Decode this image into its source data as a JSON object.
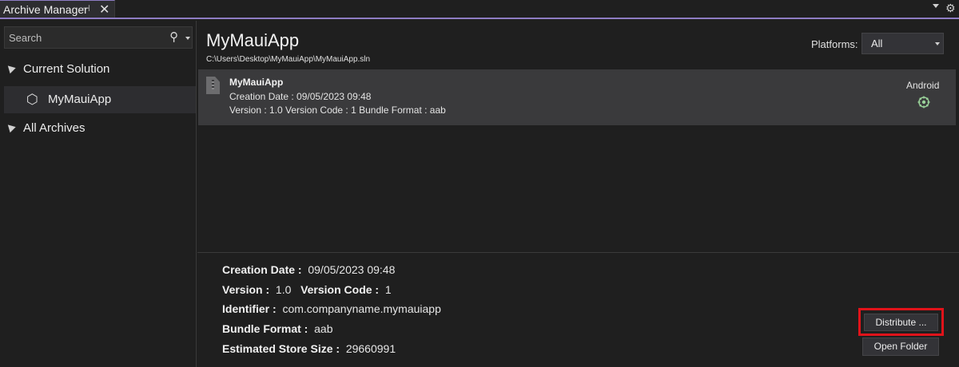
{
  "window": {
    "tab_title": "Archive Manager",
    "pin_glyph": "⊣",
    "close_glyph": "✕",
    "gear_glyph": "⚙"
  },
  "sidebar": {
    "search_placeholder": "Search",
    "tree": {
      "current_solution": "Current Solution",
      "project": "MyMauiApp",
      "all_archives": "All Archives"
    }
  },
  "header": {
    "app_name": "MyMauiApp",
    "solution_path": "C:\\Users\\Desktop\\MyMauiApp\\MyMauiApp.sln",
    "platforms_label": "Platforms:",
    "platforms_value": "All"
  },
  "archives": [
    {
      "name": "MyMauiApp",
      "creation_date_line": "Creation Date :  09/05/2023 09:48",
      "version_line": "Version :  1.0    Version Code :  1    Bundle Format :  aab",
      "platform": "Android"
    }
  ],
  "details": {
    "creation_date_label": "Creation Date :",
    "creation_date_value": "09/05/2023 09:48",
    "version_label": "Version :",
    "version_value": "1.0",
    "version_code_label": "Version Code :",
    "version_code_value": "1",
    "identifier_label": "Identifier :",
    "identifier_value": "com.companyname.mymauiapp",
    "bundle_format_label": "Bundle Format :",
    "bundle_format_value": "aab",
    "store_size_label": "Estimated Store Size :",
    "store_size_value": "29660991"
  },
  "actions": {
    "distribute_label": "Distribute ...",
    "open_folder_label": "Open Folder"
  },
  "colors": {
    "accent": "#8e7cc3",
    "highlight_border": "#e0131a",
    "background": "#1f1f1f",
    "selected_row": "#3a3a3c"
  }
}
